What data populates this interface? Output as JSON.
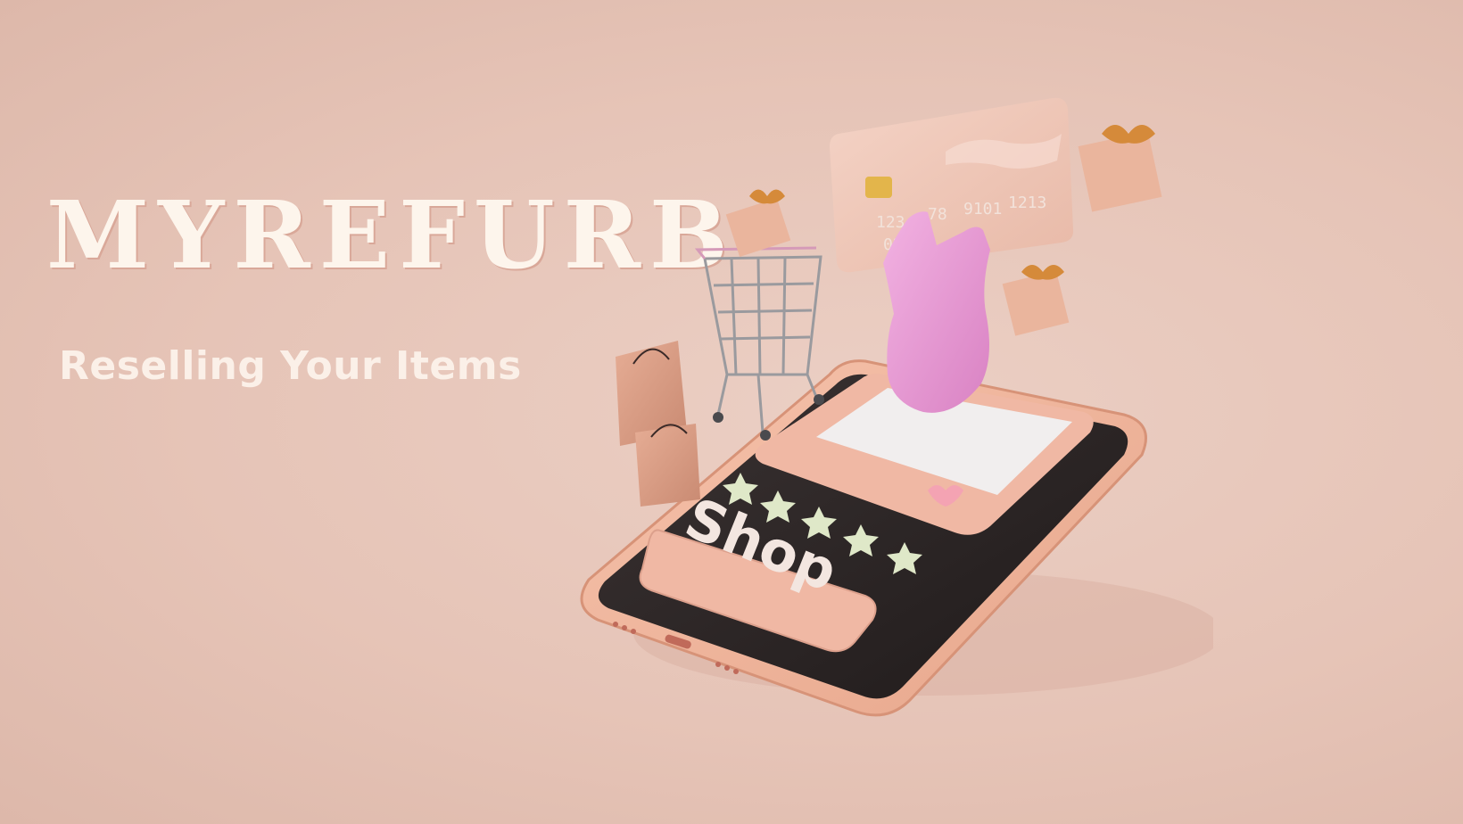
{
  "brand": {
    "title": "MYREFURB",
    "tagline": "Reselling Your Items"
  },
  "scene": {
    "shop_button_label": "Shop",
    "card_number_fragments": [
      "123",
      "78",
      "9101",
      "1213"
    ],
    "card_expiry_fragment": "02",
    "rating_stars": 5
  },
  "colors": {
    "background": "#e6c4b7",
    "title_text": "#fdf5ec",
    "phone_body": "#eeb49b",
    "phone_screen": "#2a2424",
    "star": "#dfe8c8",
    "dress": "#ec9fd6"
  },
  "icons": [
    "shopping-cart-icon",
    "shopping-bag-icon",
    "gift-box-icon",
    "credit-card-icon",
    "heart-icon",
    "star-icon",
    "dress-icon",
    "smartphone-icon"
  ]
}
